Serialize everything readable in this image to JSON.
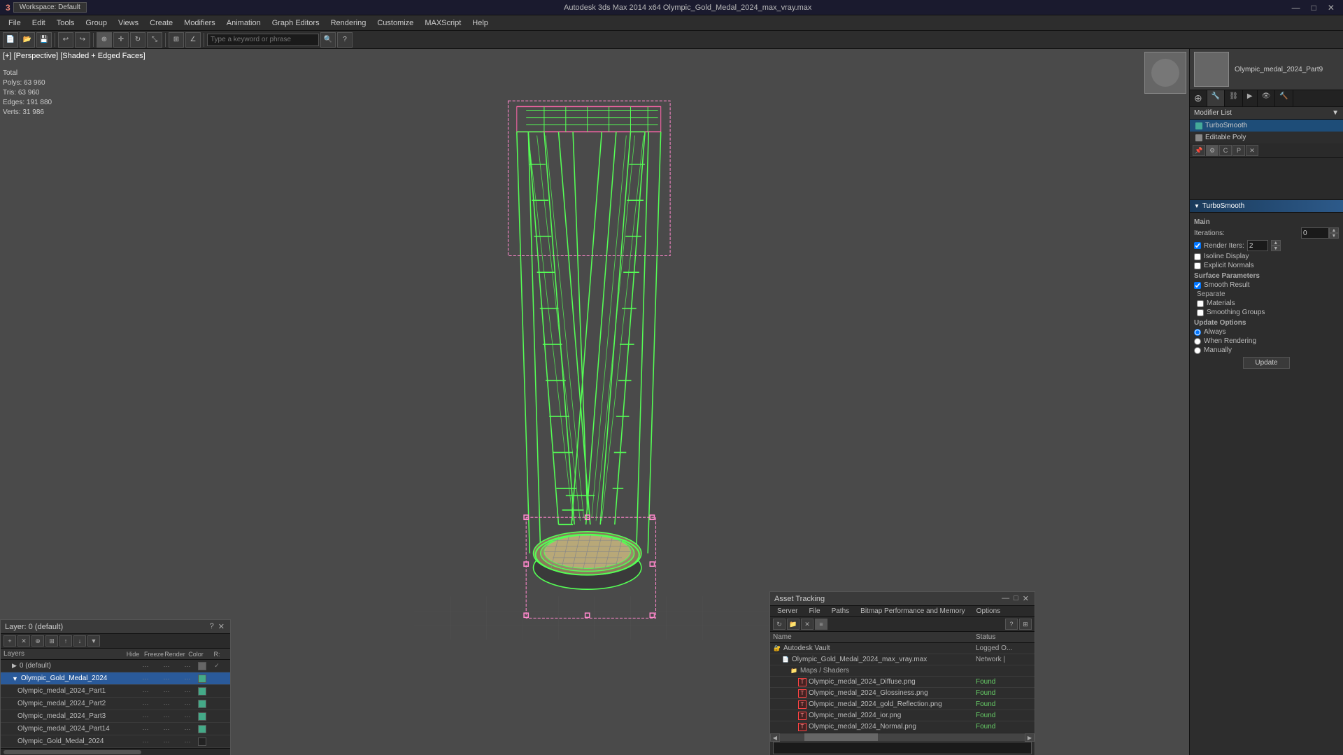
{
  "app": {
    "title": "Autodesk 3ds Max 2014 x64    Olympic_Gold_Medal_2024_max_vray.max",
    "workspace": "Workspace: Default",
    "logo": "3ds"
  },
  "titlebar": {
    "minimize": "—",
    "maximize": "□",
    "close": "✕"
  },
  "menubar": {
    "items": [
      "File",
      "Edit",
      "Tools",
      "Group",
      "Views",
      "Create",
      "Modifiers",
      "Animation",
      "Graph Editors",
      "Rendering",
      "Customize",
      "MAXScript",
      "Help"
    ]
  },
  "toolbar": {
    "search_placeholder": "Type a keyword or phrase"
  },
  "viewport": {
    "label": "[+] [Perspective] [Shaded + Edged Faces]",
    "stats": {
      "total_label": "Total",
      "polys_label": "Polys:",
      "polys_value": "63 960",
      "tris_label": "Tris:",
      "tris_value": "63 960",
      "edges_label": "Edges:",
      "edges_value": "191 880",
      "verts_label": "Verts:",
      "verts_value": "31 986"
    }
  },
  "modifier_panel": {
    "object_name": "Olympic_medal_2024_Part9",
    "list_label": "Modifier List",
    "modifiers": [
      {
        "name": "TurboSmooth",
        "type": "turbo"
      },
      {
        "name": "Editable Poly",
        "type": "edpoly"
      }
    ],
    "turbosmooth": {
      "title": "TurboSmooth",
      "main_label": "Main",
      "iterations_label": "Iterations:",
      "iterations_value": "0",
      "render_iters_label": "Render Iters:",
      "render_iters_value": "2",
      "isoline_display": "Isoline Display",
      "explicit_normals": "Explicit Normals",
      "surface_params_label": "Surface Parameters",
      "smooth_result": "Smooth Result",
      "separate_label": "Separate",
      "materials": "Materials",
      "smoothing_groups": "Smoothing Groups",
      "update_options_label": "Update Options",
      "always": "Always",
      "when_rendering": "When Rendering",
      "manually": "Manually",
      "update_btn": "Update"
    }
  },
  "layers_panel": {
    "title": "Layer: 0 (default)",
    "question": "?",
    "close": "✕",
    "header": "Layers",
    "col_hide": "Hide",
    "col_freeze": "Freeze",
    "col_render": "Render",
    "col_color": "Color",
    "col_r": "R:",
    "rows": [
      {
        "indent": 0,
        "name": "0 (default)",
        "hide": "...",
        "freeze": "...",
        "render": "...",
        "color": "#555",
        "checked": true
      },
      {
        "indent": 0,
        "name": "Olympic_Gold_Medal_2024",
        "hide": "...",
        "freeze": "...",
        "render": "...",
        "color": "#4a8",
        "selected": true
      },
      {
        "indent": 1,
        "name": "Olympic_medal_2024_Part1",
        "hide": "...",
        "freeze": "...",
        "render": "...",
        "color": "#4a8"
      },
      {
        "indent": 1,
        "name": "Olympic_medal_2024_Part2",
        "hide": "...",
        "freeze": "...",
        "render": "...",
        "color": "#4a8"
      },
      {
        "indent": 1,
        "name": "Olympic_medal_2024_Part3",
        "hide": "...",
        "freeze": "...",
        "render": "...",
        "color": "#4a8"
      },
      {
        "indent": 1,
        "name": "Olympic_medal_2024_Part14",
        "hide": "...",
        "freeze": "...",
        "render": "...",
        "color": "#4a8"
      },
      {
        "indent": 1,
        "name": "Olympic_Gold_Medal_2024",
        "hide": "...",
        "freeze": "...",
        "render": "...",
        "color": "#222"
      }
    ]
  },
  "asset_panel": {
    "title": "Asset Tracking",
    "menus": [
      "Server",
      "File",
      "Paths",
      "Bitmap Performance and Memory",
      "Options"
    ],
    "col_name": "Name",
    "col_status": "Status",
    "rows": [
      {
        "indent": 0,
        "icon": "vault",
        "name": "Autodesk Vault",
        "status": "Logged O...",
        "status_type": "logged"
      },
      {
        "indent": 1,
        "icon": "file",
        "name": "Olympic_Gold_Medal_2024_max_vray.max",
        "status": "Network |",
        "status_type": "network"
      },
      {
        "indent": 2,
        "icon": "folder",
        "name": "Maps / Shaders",
        "status": "",
        "status_type": ""
      },
      {
        "indent": 3,
        "icon": "img",
        "name": "Olympic_medal_2024_Diffuse.png",
        "status": "Found",
        "status_type": "found"
      },
      {
        "indent": 3,
        "icon": "img",
        "name": "Olympic_medal_2024_Glossiness.png",
        "status": "Found",
        "status_type": "found"
      },
      {
        "indent": 3,
        "icon": "img",
        "name": "Olympic_medal_2024_gold_Reflection.png",
        "status": "Found",
        "status_type": "found"
      },
      {
        "indent": 3,
        "icon": "img",
        "name": "Olympic_medal_2024_ior.png",
        "status": "Found",
        "status_type": "found"
      },
      {
        "indent": 3,
        "icon": "img",
        "name": "Olympic_medal_2024_Normal.png",
        "status": "Found",
        "status_type": "found"
      }
    ]
  },
  "colors": {
    "selected_blue": "#2a5a9a",
    "rollout_bg": "#1a3a5a",
    "viewport_bg": "#4a4a4a",
    "accent_green": "#4a8844"
  }
}
